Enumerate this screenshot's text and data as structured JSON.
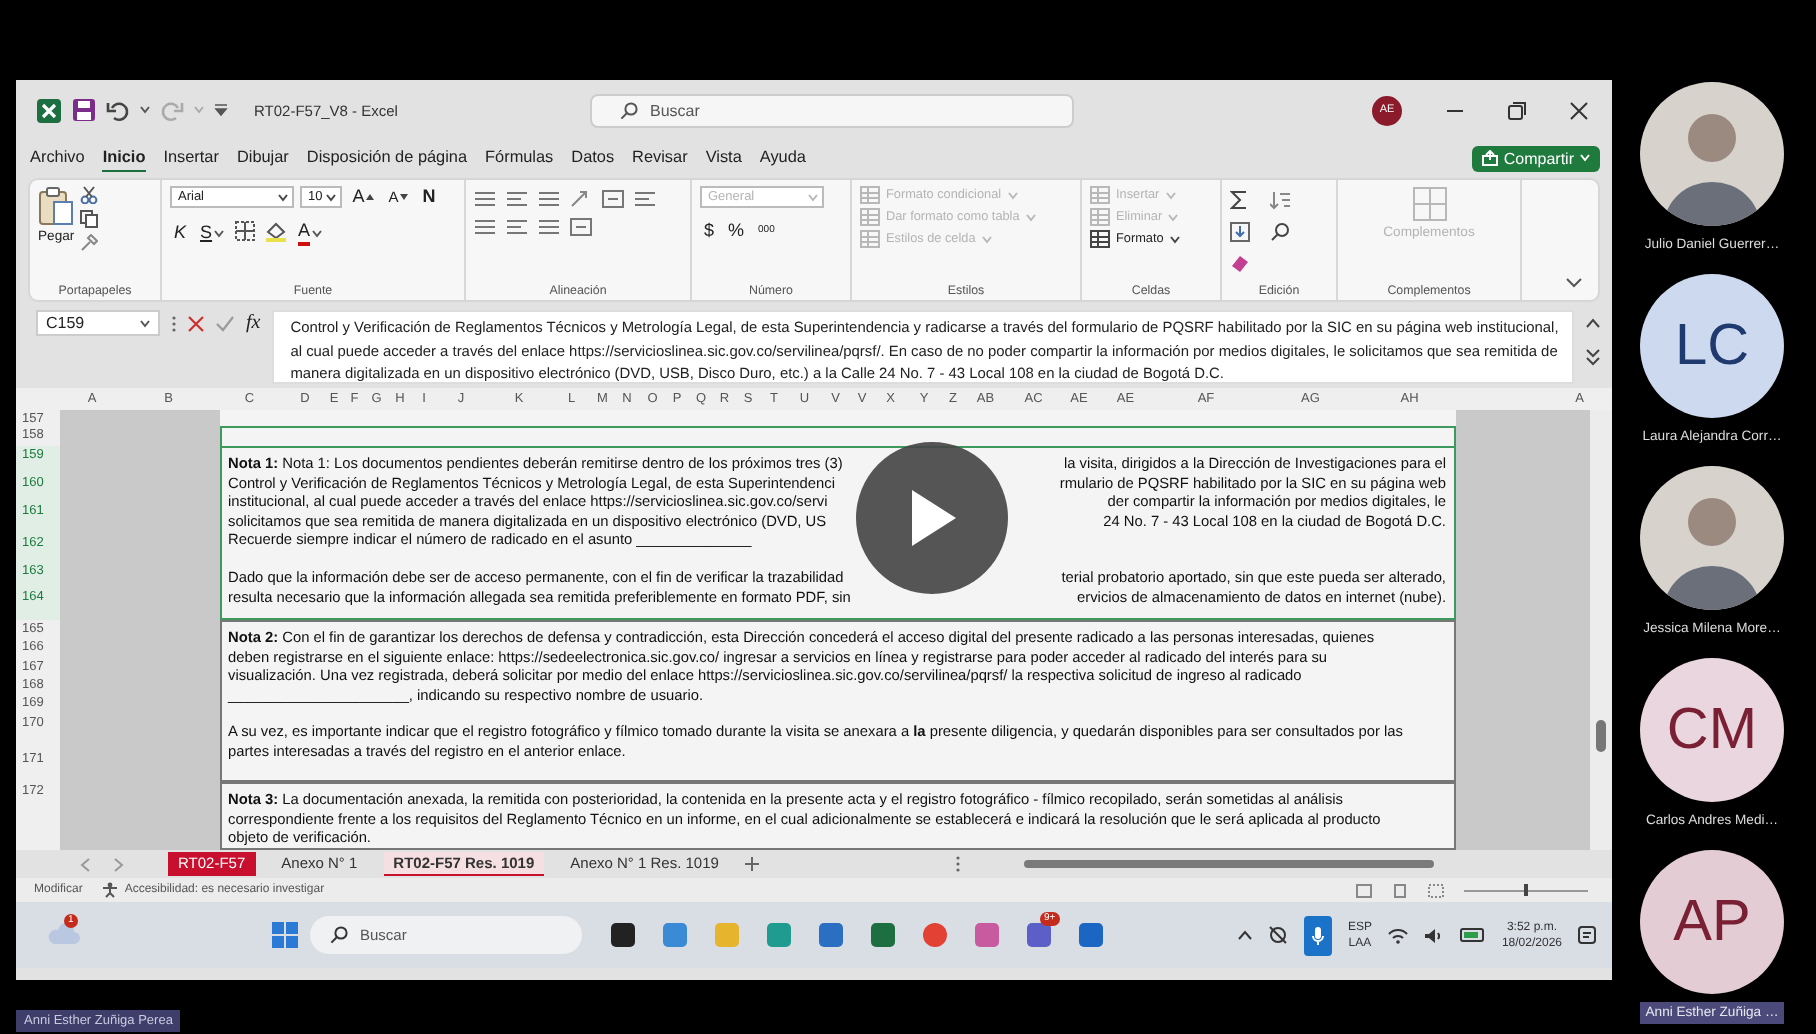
{
  "excel": {
    "title_bar": {
      "document_title": "RT02-F57_V8  -  Excel",
      "search_placeholder": "Buscar",
      "account_initials": "AE"
    },
    "menu_tabs": [
      {
        "label": "Archivo",
        "selected": false
      },
      {
        "label": "Inicio",
        "selected": true
      },
      {
        "label": "Insertar",
        "selected": false
      },
      {
        "label": "Dibujar",
        "selected": false
      },
      {
        "label": "Disposición de página",
        "selected": false
      },
      {
        "label": "Fórmulas",
        "selected": false
      },
      {
        "label": "Datos",
        "selected": false
      },
      {
        "label": "Revisar",
        "selected": false
      },
      {
        "label": "Vista",
        "selected": false
      },
      {
        "label": "Ayuda",
        "selected": false
      }
    ],
    "share_button": "Compartir",
    "ribbon_groups": [
      {
        "kind": "clipboard",
        "label": "Portapapeles",
        "controls": [
          {
            "kind": "large",
            "label": "Pegar",
            "disabled": false
          }
        ]
      },
      {
        "kind": "font",
        "label": "Fuente",
        "controls": [
          {
            "kind": "field",
            "label": "Arial",
            "disabled": false
          },
          {
            "kind": "field",
            "label": "10",
            "disabled": false
          },
          {
            "kind": "grow",
            "label": "A",
            "disabled": false
          },
          {
            "kind": "shrink",
            "label": "A",
            "disabled": false
          },
          {
            "kind": "bold",
            "label": "N",
            "disabled": false
          },
          {
            "kind": "italic",
            "label": "K",
            "disabled": false
          },
          {
            "kind": "underline",
            "label": "S",
            "disabled": false
          },
          {
            "kind": "color-glyph",
            "label": "A",
            "disabled": false
          }
        ]
      },
      {
        "kind": "alignment",
        "label": "Alineación"
      },
      {
        "kind": "number",
        "label": "Número",
        "controls": [
          {
            "kind": "field",
            "label": "General",
            "disabled": true
          },
          {
            "kind": "glyph",
            "label": "$",
            "disabled": false
          },
          {
            "kind": "glyph",
            "label": "%",
            "disabled": false
          },
          {
            "kind": "glyph",
            "label": "000",
            "disabled": false
          }
        ]
      },
      {
        "kind": "styles",
        "label": "Estilos",
        "controls": [
          {
            "kind": "small",
            "label": "Formato condicional",
            "disabled": true
          },
          {
            "kind": "small",
            "label": "Dar formato como tabla",
            "disabled": true
          },
          {
            "kind": "small",
            "label": "Estilos de celda",
            "disabled": true
          }
        ]
      },
      {
        "kind": "cells",
        "label": "Celdas",
        "controls": [
          {
            "kind": "small",
            "label": "Insertar",
            "disabled": true
          },
          {
            "kind": "small",
            "label": "Eliminar",
            "disabled": true
          },
          {
            "kind": "small",
            "label": "Formato",
            "disabled": false
          }
        ]
      },
      {
        "kind": "editing",
        "label": "Edición"
      },
      {
        "kind": "addins",
        "label": "Complementos",
        "controls": [
          {
            "kind": "large",
            "label": "Complementos",
            "disabled": true
          }
        ]
      }
    ],
    "formula_bar": {
      "name_box": "C159",
      "function_label": "fx",
      "formula": "Control y Verificación de Reglamentos Técnicos y Metrología Legal, de esta Superintendencia y radicarse a través del formulario de PQSRF habilitado por la SIC en su página web institucional, al cual puede acceder a través del enlace https://servicioslinea.sic.gov.co/servilinea/pqrsf/. En caso de no poder compartir la información por medios digitales, le solicitamos que sea remitida de manera digitalizada en un dispositivo electrónico (DVD, USB, Disco Duro, etc.) a la Calle 24 No. 7 - 43 Local 108 en la ciudad de Bogotá D.C."
    },
    "sheet": {
      "column_headers": [
        "A",
        "B",
        "C",
        "D",
        "E",
        "F",
        "G",
        "H",
        "I",
        "J",
        "K",
        "L",
        "M",
        "N",
        "O",
        "P",
        "Q",
        "R",
        "S",
        "T",
        "U",
        "V",
        "V",
        "X",
        "Y",
        "Z",
        "AB",
        "AC",
        "AE",
        "AE",
        "AF",
        "AG",
        "AH",
        "A"
      ],
      "row_numbers": [
        {
          "label": "157",
          "selected": false
        },
        {
          "label": "158",
          "selected": false
        },
        {
          "label": "159",
          "selected": true
        },
        {
          "label": "160",
          "selected": true
        },
        {
          "label": "161",
          "selected": true
        },
        {
          "label": "162",
          "selected": true
        },
        {
          "label": "163",
          "selected": true
        },
        {
          "label": "164",
          "selected": true
        },
        {
          "label": "165",
          "selected": false
        },
        {
          "label": "166",
          "selected": false
        },
        {
          "label": "167",
          "selected": false
        },
        {
          "label": "168",
          "selected": false
        },
        {
          "label": "169",
          "selected": false
        },
        {
          "label": "170",
          "selected": false
        },
        {
          "label": "171",
          "selected": false
        },
        {
          "label": "172",
          "selected": false
        }
      ],
      "notes": [
        {
          "selected": true,
          "paragraphs": [
            [
              {
                "left": "**Nota 1:** Nota 1: Los documentos pendientes deberán remitirse dentro de los próximos tres (3)",
                "right": "la visita, dirigidos a la Dirección de Investigaciones para el"
              },
              {
                "left": "Control y Verificación de Reglamentos Técnicos y Metrología Legal, de esta Superintendenci",
                "right": "rmulario de PQSRF habilitado por la SIC en su página web"
              },
              {
                "left": "institucional, al cual puede acceder a través del enlace https://servicioslinea.sic.gov.co/servi",
                "right": "der compartir la información por medios digitales, le"
              },
              {
                "left": "solicitamos que sea remitida de manera digitalizada en un dispositivo electrónico (DVD, US",
                "right": "24 No. 7 - 43 Local 108 en la ciudad de Bogotá D.C."
              },
              {
                "text": "Recuerde siempre indicar el número de radicado en el asunto ______________"
              }
            ],
            [
              {
                "left": "Dado que la información debe ser de acceso permanente, con el fin de verificar la trazabilidad",
                "right": "terial probatorio aportado, sin que este pueda ser alterado,"
              },
              {
                "left": "resulta necesario que la información allegada sea remitida preferiblemente en formato PDF, sin",
                "right": "ervicios de almacenamiento de datos en internet (nube)."
              }
            ]
          ]
        },
        {
          "selected": false,
          "paragraphs": [
            [
              {
                "text": "**Nota 2:** Con el fin de garantizar los derechos de defensa y contradicción, esta Dirección concederá el acceso digital del presente radicado a las personas interesadas, quienes"
              },
              {
                "text": "deben registrarse en el siguiente enlace: https://sedeelectronica.sic.gov.co/ ingresar a servicios en línea y registrarse para poder acceder al radicado del interés para su"
              },
              {
                "text": "visualización. Una vez registrada, deberá solicitar por medio del enlace https://servicioslinea.sic.gov.co/servilinea/pqrsf/ la respectiva solicitud de ingreso al radicado"
              },
              {
                "text": "______________________, indicando su respectivo nombre de usuario."
              }
            ],
            [
              {
                "text": "A su vez, es importante indicar que el registro fotográfico y fílmico tomado durante la visita se anexara a **la** presente diligencia, y quedarán disponibles para ser consultados por las"
              },
              {
                "text": "partes interesadas a través del registro en el anterior enlace."
              }
            ]
          ]
        },
        {
          "selected": false,
          "paragraphs": [
            [
              {
                "text": "**Nota 3:** La documentación anexada, la remitida con posterioridad, la contenida en la presente acta y el registro fotográfico - fílmico recopilado, serán sometidas al análisis"
              },
              {
                "text": "correspondiente frente a los requisitos del Reglamento Técnico en un informe, en el cual adicionalmente se establecerá e indicará la resolución que le será aplicada al producto"
              },
              {
                "text": "objeto de verificación."
              }
            ]
          ]
        }
      ]
    },
    "sheet_tabs": [
      {
        "label": "RT02-F57",
        "selected": false,
        "color": "#c8102e"
      },
      {
        "label": "Anexo N° 1",
        "selected": false
      },
      {
        "label": "RT02-F57 Res. 1019",
        "selected": true,
        "color": "#c8102e"
      },
      {
        "label": "Anexo N° 1  Res. 1019",
        "selected": false
      }
    ],
    "status_bar": {
      "mode": "Modificar",
      "accessibility": "Accesibilidad: es necesario investigar",
      "zoom": {
        "level": 0.5
      }
    }
  },
  "taskbar": {
    "weather_badge": "1",
    "search_placeholder": "Buscar",
    "app_badge": "9+",
    "language": "ESP",
    "keyboard": "LAA",
    "time": "3:52 p.m.",
    "date": "18/02/2026"
  },
  "participants": [
    {
      "kind": "photo",
      "name": "Julio Daniel Guerrer…",
      "highlighted": false
    },
    {
      "kind": "initials",
      "initials": "LC",
      "color": "#cdd9ee",
      "name": "Laura Alejandra Corr…",
      "highlighted": false
    },
    {
      "kind": "photo",
      "name": "Jessica Milena More…",
      "highlighted": false
    },
    {
      "kind": "initials",
      "initials": "CM",
      "color": "#ead6de",
      "name": "Carlos Andres Medi…",
      "highlighted": false
    },
    {
      "kind": "initials",
      "initials": "AP",
      "color": "#e3ccd3",
      "name": "Anni Esther Zuñiga …",
      "highlighted": true
    }
  ],
  "presenter_label": "Anni Esther Zuñiga Perea"
}
